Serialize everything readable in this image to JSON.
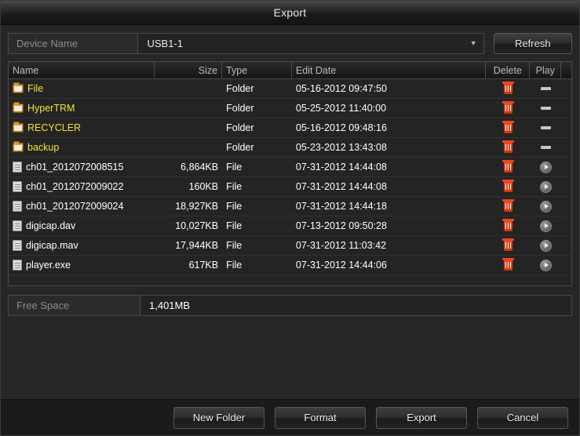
{
  "window": {
    "title": "Export"
  },
  "device": {
    "label": "Device Name",
    "value": "USB1-1",
    "caret": "chevron-down-icon",
    "refresh_label": "Refresh"
  },
  "table": {
    "headers": {
      "name": "Name",
      "size": "Size",
      "type": "Type",
      "date": "Edit Date",
      "delete": "Delete",
      "play": "Play"
    },
    "rows": [
      {
        "kind": "folder",
        "name": "File",
        "size": "",
        "type": "Folder",
        "date": "05-16-2012 09:47:50",
        "play": "dash"
      },
      {
        "kind": "folder",
        "name": "HyperTRM",
        "size": "",
        "type": "Folder",
        "date": "05-25-2012 11:40:00",
        "play": "dash"
      },
      {
        "kind": "folder",
        "name": "RECYCLER",
        "size": "",
        "type": "Folder",
        "date": "05-16-2012 09:48:16",
        "play": "dash"
      },
      {
        "kind": "folder",
        "name": "backup",
        "size": "",
        "type": "Folder",
        "date": "05-23-2012 13:43:08",
        "play": "dash"
      },
      {
        "kind": "file",
        "name": "ch01_2012072008515",
        "size": "6,864KB",
        "type": "File",
        "date": "07-31-2012 14:44:08",
        "play": "play"
      },
      {
        "kind": "file",
        "name": "ch01_2012072009022",
        "size": "160KB",
        "type": "File",
        "date": "07-31-2012 14:44:08",
        "play": "play"
      },
      {
        "kind": "file",
        "name": "ch01_2012072009024",
        "size": "18,927KB",
        "type": "File",
        "date": "07-31-2012 14:44:18",
        "play": "play"
      },
      {
        "kind": "file",
        "name": "digicap.dav",
        "size": "10,027KB",
        "type": "File",
        "date": "07-13-2012 09:50:28",
        "play": "play"
      },
      {
        "kind": "file",
        "name": "digicap.mav",
        "size": "17,944KB",
        "type": "File",
        "date": "07-31-2012 11:03:42",
        "play": "play"
      },
      {
        "kind": "file",
        "name": "player.exe",
        "size": "617KB",
        "type": "File",
        "date": "07-31-2012 14:44:06",
        "play": "play"
      }
    ]
  },
  "free_space": {
    "label": "Free Space",
    "value": "1,401MB"
  },
  "footer": {
    "new_folder": "New Folder",
    "format": "Format",
    "export": "Export",
    "cancel": "Cancel"
  },
  "colors": {
    "folder_text": "#f2e532",
    "file_text": "#ffffff",
    "delete_icon": "#e8491f",
    "window_bg": "#262626"
  }
}
